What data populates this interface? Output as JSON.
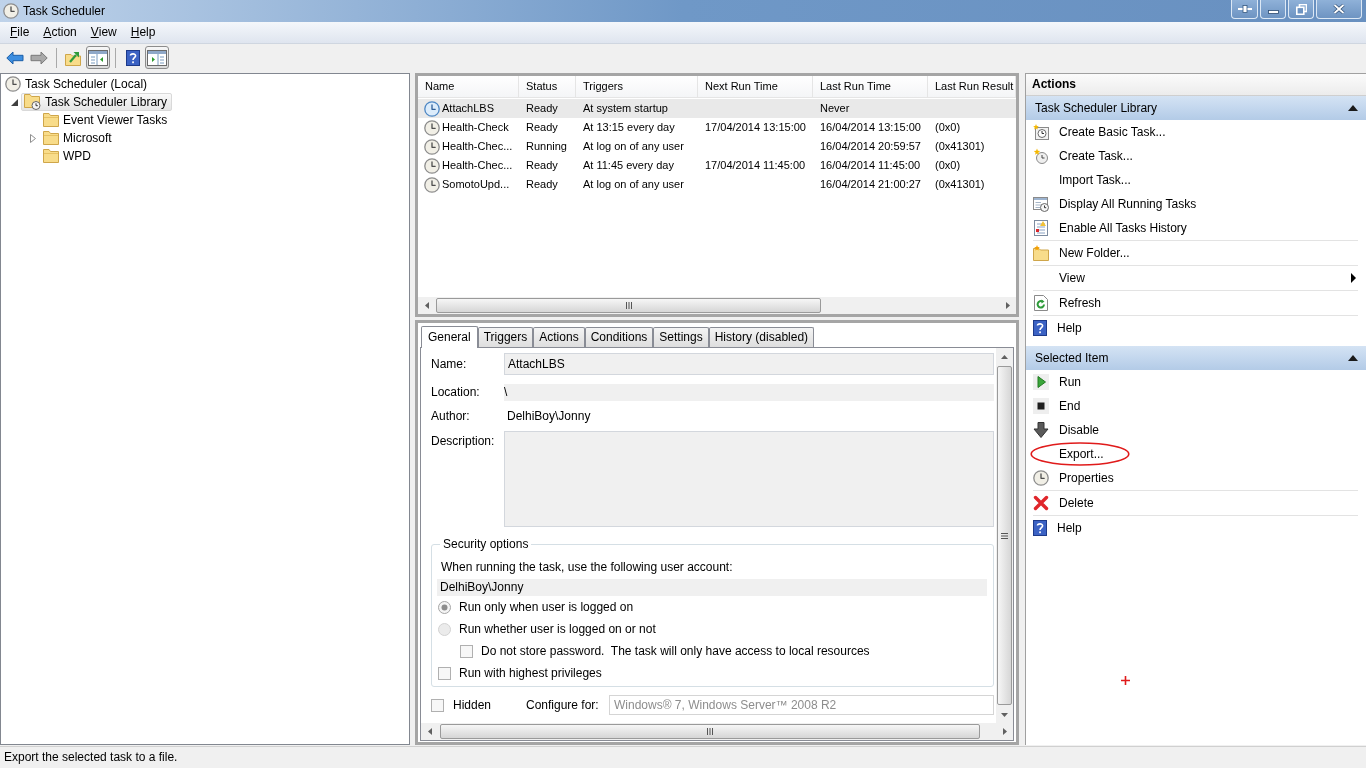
{
  "window": {
    "title": "Task Scheduler"
  },
  "menu": [
    {
      "label": "File"
    },
    {
      "label": "Action"
    },
    {
      "label": "View"
    },
    {
      "label": "Help"
    }
  ],
  "toolbar": [
    {
      "items": [
        {
          "kind": "back",
          "disabled": false,
          "pressed": false
        },
        {
          "kind": "forward",
          "disabled": true,
          "pressed": false
        }
      ]
    },
    {
      "items": [
        {
          "kind": "up",
          "disabled": false,
          "pressed": false
        },
        {
          "kind": "tree-pane",
          "disabled": false,
          "pressed": true
        }
      ]
    },
    {
      "items": [
        {
          "kind": "help",
          "disabled": false,
          "pressed": false
        },
        {
          "kind": "actions-pane",
          "disabled": false,
          "pressed": true
        }
      ]
    }
  ],
  "tree": [
    {
      "label": "Task Scheduler (Local)",
      "kind": "clock",
      "selected": false,
      "children": [
        {
          "label": "Task Scheduler Library",
          "kind": "clock-folder",
          "selected": true,
          "expanded": true,
          "children": [
            {
              "label": "Event Viewer Tasks",
              "kind": "folder",
              "selected": false
            },
            {
              "label": "Microsoft",
              "kind": "folder",
              "selected": false,
              "expanded": false
            },
            {
              "label": "WPD",
              "kind": "folder",
              "selected": false
            }
          ]
        }
      ]
    }
  ],
  "task_list": {
    "columns": [
      "Name",
      "Status",
      "Triggers",
      "Next Run Time",
      "Last Run Time",
      "Last Run Result"
    ],
    "rows": [
      {
        "name": "AttachLBS",
        "status": "Ready",
        "triggers": "At system startup",
        "last_run_time": "Never",
        "selected": true
      },
      {
        "name": "Health-Check",
        "status": "Ready",
        "triggers": "At 13:15 every day",
        "next_run_time": "17/04/2014 13:15:00",
        "last_run_time": "16/04/2014 13:15:00",
        "last_run_result": "(0x0)",
        "selected": false
      },
      {
        "name": "Health-Chec...",
        "status": "Running",
        "triggers": "At log on of any user",
        "last_run_time": "16/04/2014 20:59:57",
        "last_run_result": "(0x41301)",
        "selected": false
      },
      {
        "name": "Health-Chec...",
        "status": "Ready",
        "triggers": "At 11:45 every day",
        "next_run_time": "17/04/2014 11:45:00",
        "last_run_time": "16/04/2014 11:45:00",
        "last_run_result": "(0x0)",
        "selected": false
      },
      {
        "name": "SomotoUpd...",
        "status": "Ready",
        "triggers": "At log on of any user",
        "last_run_time": "16/04/2014 21:00:27",
        "last_run_result": "(0x41301)",
        "selected": false
      }
    ]
  },
  "details": {
    "tabs": [
      {
        "label": "General",
        "selected": true
      },
      {
        "label": "Triggers",
        "selected": false
      },
      {
        "label": "Actions",
        "selected": false
      },
      {
        "label": "Conditions",
        "selected": false
      },
      {
        "label": "Settings",
        "selected": false
      },
      {
        "label": "History (disabled)",
        "selected": false
      }
    ],
    "general": {
      "fields": [
        {
          "label": "Name:",
          "value": "AttachLBS",
          "kind": "box"
        },
        {
          "label": "Location:",
          "value": "\\",
          "kind": "shaded"
        },
        {
          "label": "Author:",
          "value": "DelhiBoy\\Jonny",
          "kind": "plain"
        },
        {
          "label": "Description:",
          "kind": "multiline"
        }
      ],
      "security": {
        "title": "Security options",
        "prompt": "When running the task, use the following user account:",
        "account": "DelhiBoy\\Jonny",
        "options": [
          {
            "kind": "radio",
            "label": "Run only when user is logged on",
            "selected": true
          },
          {
            "kind": "radio",
            "label": "Run whether user is logged on or not",
            "selected": false,
            "children": [
              {
                "kind": "checkbox",
                "label": "Do not store password.  The task will only have access to local resources",
                "checked": false
              }
            ]
          },
          {
            "kind": "checkbox",
            "label": "Run with highest privileges",
            "checked": false
          }
        ]
      },
      "hidden": {
        "label": "Hidden",
        "checked": false
      },
      "configure_for": {
        "label": "Configure for:",
        "value": "Windows® 7, Windows Server™ 2008 R2"
      }
    }
  },
  "actions_pane": {
    "title": "Actions",
    "sections": [
      {
        "title": "Task Scheduler Library",
        "expanded": true,
        "groups": [
          {
            "items": [
              {
                "label": "Create Basic Task...",
                "kind": "create-basic-task",
                "submenu": false,
                "circled": false
              },
              {
                "label": "Create Task...",
                "kind": "create-task",
                "submenu": false,
                "circled": false
              },
              {
                "label": "Import Task...",
                "kind": "plain",
                "submenu": false,
                "circled": false
              },
              {
                "label": "Display All Running Tasks",
                "kind": "running-tasks",
                "submenu": false,
                "circled": false
              },
              {
                "label": "Enable All Tasks History",
                "kind": "history",
                "submenu": false,
                "circled": false
              }
            ]
          },
          {
            "items": [
              {
                "label": "New Folder...",
                "kind": "new-folder",
                "submenu": false,
                "circled": false
              }
            ]
          },
          {
            "items": [
              {
                "label": "View",
                "kind": "plain",
                "submenu": true,
                "circled": false
              }
            ]
          },
          {
            "items": [
              {
                "label": "Refresh",
                "kind": "refresh",
                "submenu": false,
                "circled": false
              }
            ]
          },
          {
            "items": [
              {
                "label": "Help",
                "kind": "help",
                "submenu": false,
                "circled": false
              }
            ]
          }
        ]
      },
      {
        "title": "Selected Item",
        "expanded": true,
        "groups": [
          {
            "items": [
              {
                "label": "Run",
                "kind": "run",
                "submenu": false,
                "circled": false
              },
              {
                "label": "End",
                "kind": "end",
                "submenu": false,
                "circled": false
              },
              {
                "label": "Disable",
                "kind": "disable",
                "submenu": false,
                "circled": false
              },
              {
                "label": "Export...",
                "kind": "plain",
                "submenu": false,
                "circled": true
              },
              {
                "label": "Properties",
                "kind": "properties",
                "submenu": false,
                "circled": false
              }
            ]
          },
          {
            "items": [
              {
                "label": "Delete",
                "kind": "delete",
                "submenu": false,
                "circled": false
              }
            ]
          },
          {
            "items": [
              {
                "label": "Help",
                "kind": "help",
                "submenu": false,
                "circled": false
              }
            ]
          }
        ]
      }
    ]
  },
  "status_bar": {
    "text": "Export the selected task to a file."
  }
}
